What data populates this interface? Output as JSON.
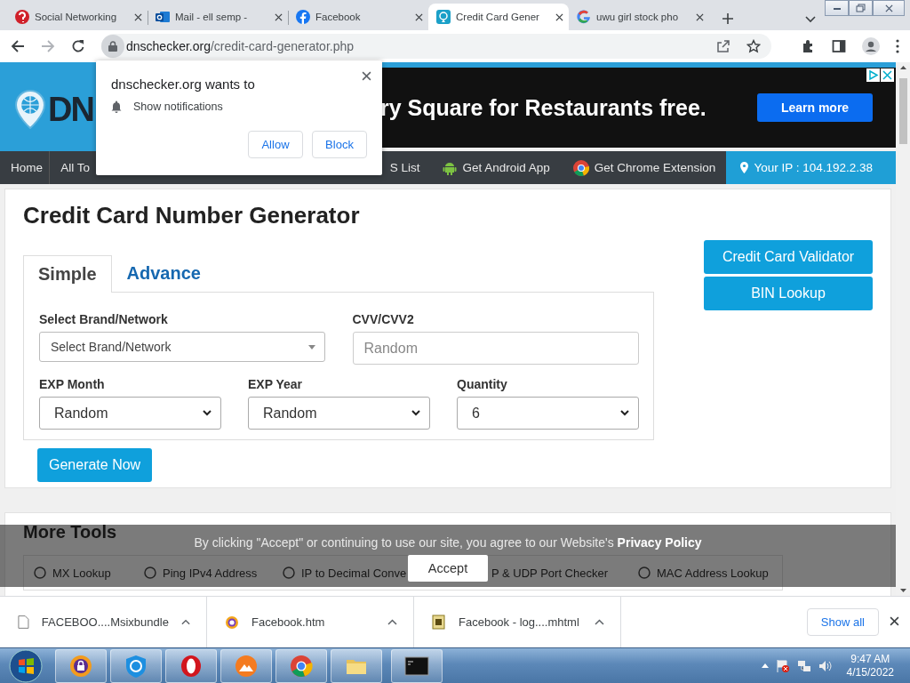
{
  "browser": {
    "tabs": [
      {
        "title": "Social Networking",
        "selected": false
      },
      {
        "title": "Mail - ell semp -",
        "selected": false
      },
      {
        "title": "Facebook",
        "selected": false
      },
      {
        "title": "Credit Card Gener",
        "selected": true
      },
      {
        "title": "uwu girl stock pho",
        "selected": false
      }
    ],
    "address": {
      "host": "dnschecker.org",
      "path": "/credit-card-generator.php"
    }
  },
  "notification": {
    "title": "dnschecker.org wants to",
    "permission": "Show notifications",
    "buttons": [
      "Allow",
      "Block"
    ]
  },
  "header": {
    "logo": "DN",
    "ad_text": "ry Square for Restaurants free.",
    "ad_button": "Learn more"
  },
  "nav": {
    "items": [
      "Home",
      "All To",
      "S List",
      "Get Android App",
      "Get Chrome Extension"
    ],
    "ip": "Your IP : 104.192.2.38"
  },
  "generator": {
    "title": "Credit Card Number Generator",
    "tabs": [
      {
        "label": "Simple",
        "selected": true
      },
      {
        "label": "Advance",
        "selected": false
      }
    ],
    "fields": [
      {
        "label": "Select Brand/Network",
        "kind": "combo",
        "value": "Select Brand/Network"
      },
      {
        "label": "CVV/CVV2",
        "kind": "input",
        "placeholder": "Random"
      },
      {
        "label": "EXP Month",
        "kind": "select",
        "value": "Random"
      },
      {
        "label": "EXP Year",
        "kind": "select",
        "value": "Random"
      },
      {
        "label": "Quantity",
        "kind": "select",
        "value": "6"
      }
    ],
    "generate_button": "Generate Now",
    "side_buttons": [
      "Credit Card Validator",
      "BIN Lookup"
    ]
  },
  "more_tools": {
    "title": "More Tools",
    "tools": [
      "MX Lookup",
      "Ping IPv4 Address",
      "IP to Decimal Conve",
      "P & UDP Port Checker",
      "MAC Address Lookup"
    ]
  },
  "cookie_banner": {
    "text": "By clicking \"Accept\" or continuing to use our site, you agree to our Website's",
    "link": "Privacy Policy",
    "button": "Accept"
  },
  "downloads": {
    "items": [
      "FACEBOO....Msixbundle",
      "Facebook.htm",
      "Facebook - log....mhtml"
    ],
    "show_all": "Show all"
  },
  "taskbar": {
    "time": "9:47 AM",
    "date": "4/15/2022"
  }
}
